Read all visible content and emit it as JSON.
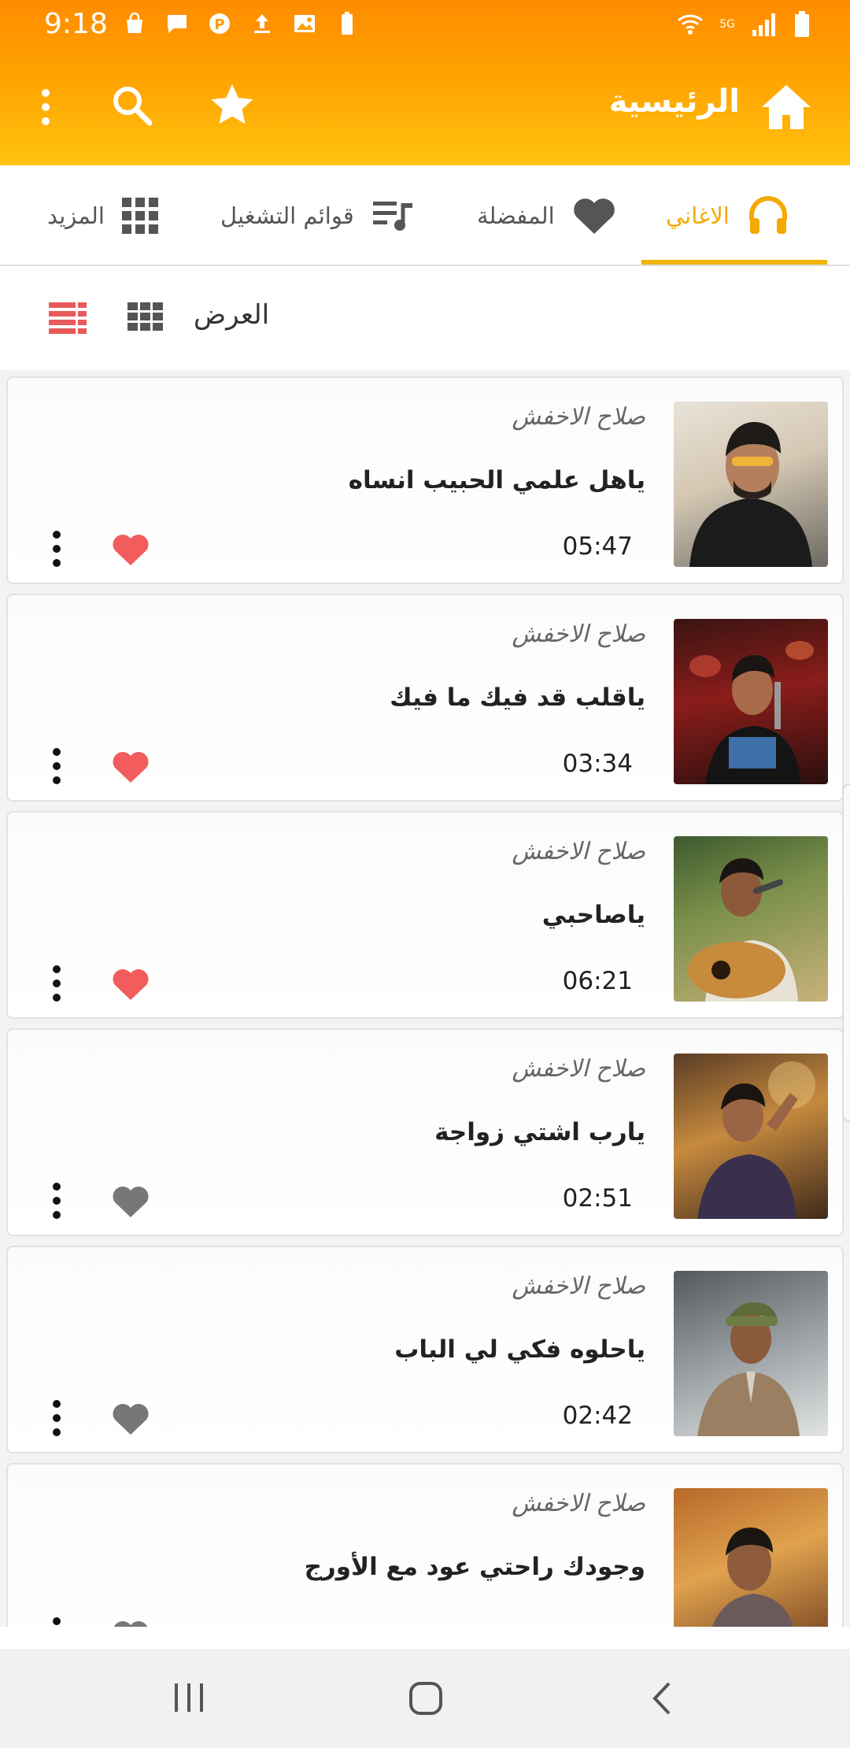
{
  "status_bar": {
    "time": "9:18",
    "battery_small_label": "100",
    "network_label": "5G"
  },
  "app_bar": {
    "title": "الرئيسية",
    "icons": [
      "home-icon",
      "star-icon",
      "search-icon",
      "more-vert-icon"
    ]
  },
  "tabs": [
    {
      "label": "الاغاني",
      "icon": "headphones-icon",
      "active": true
    },
    {
      "label": "المفضلة",
      "icon": "heart-icon",
      "active": false
    },
    {
      "label": "قوائم التشغيل",
      "icon": "playlist-icon",
      "active": false
    },
    {
      "label": "المزيد",
      "icon": "apps-grid-icon",
      "active": false
    }
  ],
  "view_bar": {
    "label": "العرض",
    "icons": [
      "grid-view-icon",
      "list-view-icon"
    ]
  },
  "songs": [
    {
      "artist": "صلاح الاخفش",
      "title": "ياهل علمي الحبيب انساه",
      "duration": "05:47",
      "favorite": true
    },
    {
      "artist": "صلاح الاخفش",
      "title": "ياقلب قد فيك ما فيك",
      "duration": "03:34",
      "favorite": true
    },
    {
      "artist": "صلاح الاخفش",
      "title": "ياصاحبي",
      "duration": "06:21",
      "favorite": true
    },
    {
      "artist": "صلاح الاخفش",
      "title": "يارب اشتي زواجة",
      "duration": "02:51",
      "favorite": false
    },
    {
      "artist": "صلاح الاخفش",
      "title": "ياحلوه فكي لي الباب",
      "duration": "02:42",
      "favorite": false
    },
    {
      "artist": "صلاح الاخفش",
      "title": "وجودك راحتي عود مع الأورج",
      "duration": "",
      "favorite": false
    }
  ],
  "colors": {
    "accent": "#f2a900",
    "header_top": "#ff8c00",
    "header_bottom": "#ffc20e",
    "favorite_on": "#f25c5c",
    "favorite_off": "#777777"
  },
  "nav_bar": {
    "icons": [
      "recent-apps-icon",
      "home-button-icon",
      "back-icon"
    ]
  }
}
